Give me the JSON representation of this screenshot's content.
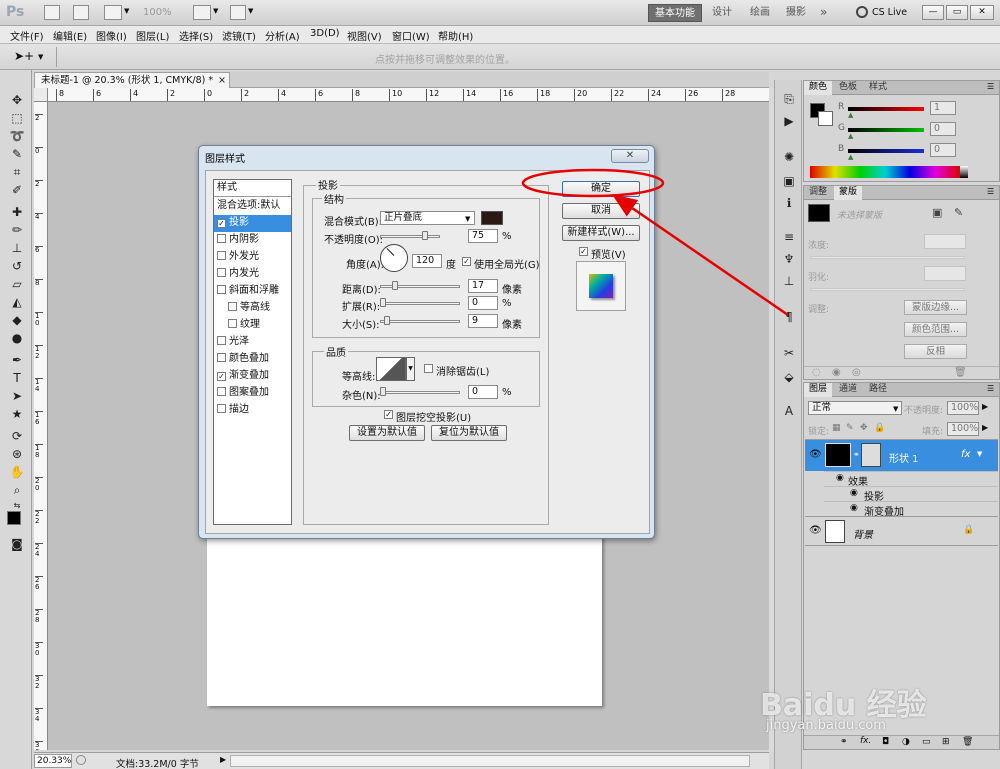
{
  "app": {
    "logo": "Ps",
    "zoom": "100%",
    "workspaces": [
      "基本功能",
      "设计",
      "绘画",
      "摄影"
    ],
    "more": "»",
    "cs_live": "CS Live",
    "window_controls": [
      "—",
      "▭",
      "✕"
    ]
  },
  "menu": [
    "文件(F)",
    "编辑(E)",
    "图像(I)",
    "图层(L)",
    "选择(S)",
    "滤镜(T)",
    "分析(A)",
    "3D(D)",
    "视图(V)",
    "窗口(W)",
    "帮助(H)"
  ],
  "options_bar": {
    "hint": "点按并拖移可调整效果的位置。"
  },
  "document": {
    "tab": "未标题-1 @ 20.3% (形状 1, CMYK/8) *",
    "tab_close": "×",
    "ruler_h": [
      "8",
      "6",
      "4",
      "2",
      "0",
      "2",
      "4",
      "6",
      "8",
      "10",
      "12",
      "14",
      "16",
      "18",
      "20",
      "22",
      "24",
      "26",
      "28"
    ],
    "ruler_v": [
      "2",
      "0",
      "2",
      "4",
      "6",
      "8",
      "1 0",
      "1 2",
      "1 4",
      "1 6",
      "1 8",
      "2 0",
      "2 2",
      "2 4",
      "2 6",
      "2 8",
      "3 0",
      "3 2",
      "3 4",
      "3 6"
    ],
    "zoom": "20.33%",
    "doc_info": "文档:33.2M/0 字节"
  },
  "color_panel": {
    "tabs": [
      "颜色",
      "色板",
      "样式"
    ],
    "channels": [
      {
        "label": "R",
        "value": "1",
        "color": "#d20000"
      },
      {
        "label": "G",
        "value": "0",
        "color": "#00a000"
      },
      {
        "label": "B",
        "value": "0",
        "color": "#1a3fd0"
      }
    ]
  },
  "adjust_panel": {
    "tabs": [
      "调整",
      "蒙版"
    ],
    "mask_title": "未选择蒙版",
    "density": "浓度:",
    "feather": "羽化:",
    "refine": "调整:",
    "buttons": [
      "蒙版边缘...",
      "颜色范围...",
      "反相"
    ]
  },
  "layers_panel": {
    "tabs": [
      "图层",
      "通道",
      "路径"
    ],
    "blend_mode": "正常",
    "opacity_label": "不透明度:",
    "opacity": "100%",
    "lock_label": "锁定:",
    "fill_label": "填充:",
    "fill": "100%",
    "layers": [
      {
        "name": "形状 1",
        "fx": "fx",
        "effects_label": "效果",
        "effects": [
          "投影",
          "渐变叠加"
        ]
      },
      {
        "name": "背景"
      }
    ]
  },
  "dialog": {
    "title": "图层样式",
    "close": "✕",
    "styles_header": "样式",
    "styles": [
      {
        "label": "混合选项:默认",
        "checkbox": false,
        "checked": false
      },
      {
        "label": "投影",
        "checkbox": true,
        "checked": true
      },
      {
        "label": "内阴影",
        "checkbox": true,
        "checked": false
      },
      {
        "label": "外发光",
        "checkbox": true,
        "checked": false
      },
      {
        "label": "内发光",
        "checkbox": true,
        "checked": false
      },
      {
        "label": "斜面和浮雕",
        "checkbox": true,
        "checked": false
      },
      {
        "label": "等高线",
        "checkbox": true,
        "checked": false
      },
      {
        "label": "纹理",
        "checkbox": true,
        "checked": false
      },
      {
        "label": "光泽",
        "checkbox": true,
        "checked": false
      },
      {
        "label": "颜色叠加",
        "checkbox": true,
        "checked": false
      },
      {
        "label": "渐变叠加",
        "checkbox": true,
        "checked": true
      },
      {
        "label": "图案叠加",
        "checkbox": true,
        "checked": false
      },
      {
        "label": "描边",
        "checkbox": true,
        "checked": false
      }
    ],
    "section_title": "投影",
    "structure_title": "结构",
    "blend_mode_label": "混合模式(B):",
    "blend_mode_value": "正片叠底",
    "shadow_color": "#2a1a14",
    "opacity_label": "不透明度(O):",
    "opacity_value": "75",
    "opacity_level": 0.75,
    "percent": "%",
    "angle_label": "角度(A):",
    "angle_value": "120",
    "degree": "度",
    "global_light": "使用全局光(G)",
    "distance_label": "距离(D):",
    "distance_value": "17",
    "spread_label": "扩展(R):",
    "spread_value": "0",
    "size_label": "大小(S):",
    "size_value": "9",
    "pixels": "像素",
    "quality_title": "品质",
    "contour_label": "等高线:",
    "anti_alias": "消除锯齿(L)",
    "noise_label": "杂色(N):",
    "noise_value": "0",
    "knockout": "图层挖空投影(U)",
    "make_default": "设置为默认值",
    "reset_default": "复位为默认值",
    "ok": "确定",
    "cancel": "取消",
    "new_style": "新建样式(W)...",
    "preview": "预览(V)"
  },
  "annotation": {
    "color": "#e60000"
  },
  "watermark": {
    "text": "Baidu 经验",
    "url": "jingyan.baidu.com"
  }
}
